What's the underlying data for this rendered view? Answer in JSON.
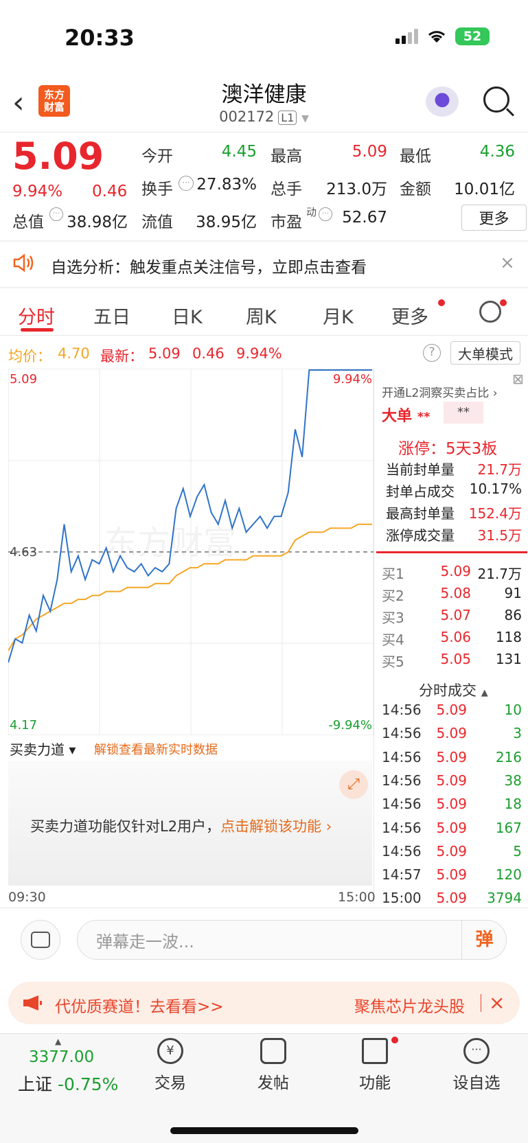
{
  "status": {
    "time": "20:33",
    "battery": "52"
  },
  "header": {
    "back": "‹",
    "logo_line1": "东方",
    "logo_line2": "财富",
    "title": "澳洋健康",
    "code": "002172",
    "level": "L1"
  },
  "quote": {
    "price": "5.09",
    "change_pct": "9.94%",
    "change_abs": "0.46",
    "open_label": "今开",
    "open": "4.45",
    "high_label": "最高",
    "high": "5.09",
    "low_label": "最低",
    "low": "4.36",
    "turnover_label": "换手",
    "turnover": "27.83%",
    "volume_label": "总手",
    "volume": "213.0万",
    "amount_label": "金额",
    "amount": "10.01亿",
    "mktcap_label": "总值",
    "mktcap": "38.98亿",
    "float_label": "流值",
    "float": "38.95亿",
    "pe_label": "市盈",
    "pe_sup": "动",
    "pe": "52.67",
    "more": "更多"
  },
  "banner": {
    "text": "自选分析：触发重点关注信号，立即点击查看",
    "close": "×"
  },
  "tabs": [
    "分时",
    "五日",
    "日K",
    "周K",
    "月K",
    "更多"
  ],
  "info": {
    "avg_label": "均价：",
    "avg": "4.70",
    "latest_label": "最新：",
    "latest": "5.09",
    "chg": "0.46",
    "pct": "9.94%",
    "help": "?",
    "mode": "大单模式"
  },
  "chart_data": {
    "type": "line",
    "title": "",
    "x_start": "09:30",
    "x_end": "15:00",
    "y_max_label": "5.09",
    "y_min_label": "4.17",
    "ref_label": "4.63",
    "pct_max_label": "9.94%",
    "pct_min_label": "-9.94%",
    "ylim": [
      4.17,
      5.09
    ],
    "ref": 4.63,
    "series": [
      {
        "name": "",
        "color": "#2f73c8",
        "values": [
          4.35,
          4.41,
          4.4,
          4.47,
          4.43,
          4.52,
          4.48,
          4.56,
          4.7,
          4.58,
          4.62,
          4.56,
          4.61,
          4.6,
          4.64,
          4.58,
          4.62,
          4.59,
          4.58,
          4.6,
          4.57,
          4.59,
          4.58,
          4.6,
          4.74,
          4.79,
          4.72,
          4.77,
          4.8,
          4.73,
          4.7,
          4.76,
          4.69,
          4.74,
          4.68,
          4.7,
          4.72,
          4.69,
          4.72,
          4.72,
          4.78,
          4.94,
          4.87,
          5.09,
          5.09,
          5.09,
          5.09,
          5.09,
          5.09,
          5.09,
          5.09,
          5.09,
          5.09
        ]
      },
      {
        "name": "",
        "color": "#f5a623",
        "values": [
          4.38,
          4.41,
          4.42,
          4.44,
          4.46,
          4.47,
          4.48,
          4.49,
          4.5,
          4.5,
          4.51,
          4.51,
          4.52,
          4.52,
          4.53,
          4.53,
          4.53,
          4.54,
          4.54,
          4.54,
          4.54,
          4.55,
          4.55,
          4.55,
          4.57,
          4.58,
          4.59,
          4.59,
          4.6,
          4.6,
          4.6,
          4.61,
          4.61,
          4.61,
          4.61,
          4.62,
          4.62,
          4.62,
          4.62,
          4.62,
          4.63,
          4.66,
          4.67,
          4.68,
          4.68,
          4.68,
          4.69,
          4.69,
          4.69,
          4.69,
          4.7,
          4.7,
          4.7
        ]
      }
    ]
  },
  "panel": {
    "l2_text": "开通L2洞察买卖占比 ›",
    "big_label": "大单",
    "big_val": "**",
    "big_box": "**",
    "limit_title": "涨停：5天3板",
    "stats": [
      {
        "label": "当前封单量",
        "value": "21.7万"
      },
      {
        "label": "封单占成交",
        "value": "10.17%"
      },
      {
        "label": "最高封单量",
        "value": "152.4万"
      },
      {
        "label": "涨停成交量",
        "value": "31.5万"
      }
    ],
    "book": [
      {
        "label": "买1",
        "price": "5.09",
        "vol": "21.7万"
      },
      {
        "label": "买2",
        "price": "5.08",
        "vol": "91"
      },
      {
        "label": "买3",
        "price": "5.07",
        "vol": "86"
      },
      {
        "label": "买4",
        "price": "5.06",
        "vol": "118"
      },
      {
        "label": "买5",
        "price": "5.05",
        "vol": "131"
      }
    ],
    "trades_title": "分时成交",
    "trades": [
      {
        "t": "14:56",
        "p": "5.09",
        "v": "10"
      },
      {
        "t": "14:56",
        "p": "5.09",
        "v": "3"
      },
      {
        "t": "14:56",
        "p": "5.09",
        "v": "216"
      },
      {
        "t": "14:56",
        "p": "5.09",
        "v": "38"
      },
      {
        "t": "14:56",
        "p": "5.09",
        "v": "18"
      },
      {
        "t": "14:56",
        "p": "5.09",
        "v": "167"
      },
      {
        "t": "14:56",
        "p": "5.09",
        "v": "5"
      },
      {
        "t": "14:57",
        "p": "5.09",
        "v": "120"
      },
      {
        "t": "15:00",
        "p": "5.09",
        "v": "3794"
      }
    ]
  },
  "force": {
    "label": "买卖力道 ▾",
    "note": "解锁查看最新实时数据",
    "locked": "买卖力道功能仅针对L2用户，",
    "cta": "点击解锁该功能 ›"
  },
  "danmaku": {
    "placeholder": "弹幕走一波...",
    "button": "弹"
  },
  "promo": {
    "text": "代优质赛道！去看看>>",
    "text2": "聚焦芯片龙头股",
    "close": "×"
  },
  "nav": {
    "index_value": "3377.00",
    "index_name": "上证",
    "index_chg": "-0.75%",
    "items": [
      "交易",
      "发帖",
      "功能",
      "设自选"
    ]
  }
}
